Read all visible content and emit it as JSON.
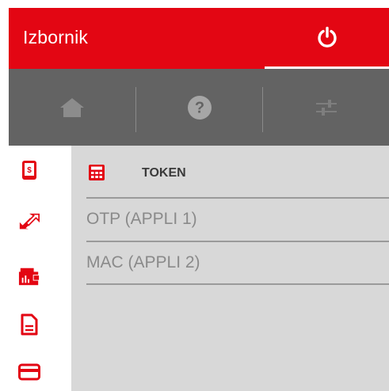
{
  "header": {
    "title": "Izbornik",
    "power_icon": "power-icon",
    "background": "#e30613"
  },
  "toolbar": {
    "items": [
      {
        "name": "home",
        "icon": "home-icon"
      },
      {
        "name": "help",
        "icon": "help-icon"
      },
      {
        "name": "settings",
        "icon": "sliders-icon"
      }
    ]
  },
  "rail": {
    "items": [
      {
        "icon": "payment-phone-icon"
      },
      {
        "icon": "transfer-icon"
      },
      {
        "icon": "accounts-icon"
      },
      {
        "icon": "document-icon"
      },
      {
        "icon": "card-icon"
      }
    ]
  },
  "token_section": {
    "title": "TOKEN",
    "icon": "calculator-icon",
    "items": [
      {
        "label": "OTP (APPLI 1)"
      },
      {
        "label": "MAC (APPLI 2)"
      }
    ]
  },
  "colors": {
    "accent": "#e30613",
    "toolbar": "#636363",
    "list_bg": "#d8d8d8"
  }
}
